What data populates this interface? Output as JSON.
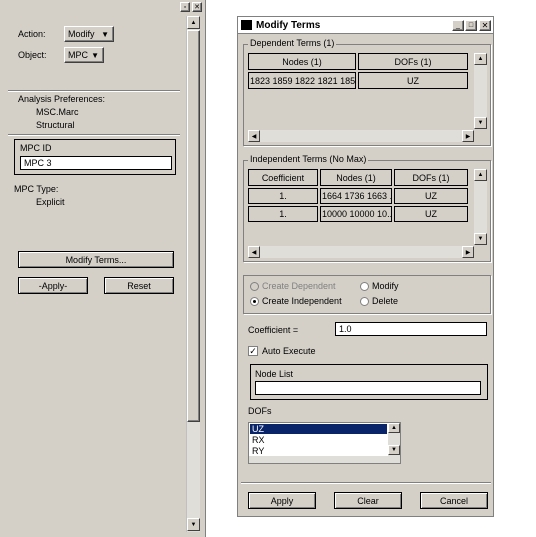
{
  "left_panel": {
    "action_label": "Action:",
    "action_value": "Modify",
    "object_label": "Object:",
    "object_value": "MPC",
    "analysis_prefs_label": "Analysis Preferences:",
    "analysis_code": "MSC.Marc",
    "analysis_type": "Structural",
    "mpc_id_label": "MPC ID",
    "mpc_id_value": "MPC 3",
    "mpc_type_label": "MPC Type:",
    "mpc_type_value": "Explicit",
    "modify_terms_button": "Modify Terms...",
    "apply_button": "-Apply-",
    "reset_button": "Reset"
  },
  "dialog": {
    "title": "Modify Terms",
    "dependent": {
      "legend": "Dependent Terms (1)",
      "columns": [
        "Nodes (1)",
        "DOFs (1)"
      ],
      "rows": [
        [
          "1823 1859 1822 1821 185...",
          "UZ"
        ]
      ]
    },
    "independent": {
      "legend": "Independent Terms (No Max)",
      "columns": [
        "Coefficient",
        "Nodes (1)",
        "DOFs (1)"
      ],
      "rows": [
        [
          "1.",
          "1664 1736 1663 ...",
          "UZ"
        ],
        [
          "1.",
          "10000 10000 10...",
          "UZ"
        ]
      ]
    },
    "options": {
      "create_dependent": "Create Dependent",
      "modify": "Modify",
      "create_independent": "Create Independent",
      "delete": "Delete"
    },
    "coefficient_label": "Coefficient =",
    "coefficient_value": "1.0",
    "auto_execute_label": "Auto Execute",
    "node_list_label": "Node List",
    "node_list_value": "",
    "dofs_label": "DOFs",
    "dofs_items": [
      "UZ",
      "RX",
      "RY"
    ],
    "dofs_selected": "UZ",
    "apply_button": "Apply",
    "clear_button": "Clear",
    "cancel_button": "Cancel"
  }
}
